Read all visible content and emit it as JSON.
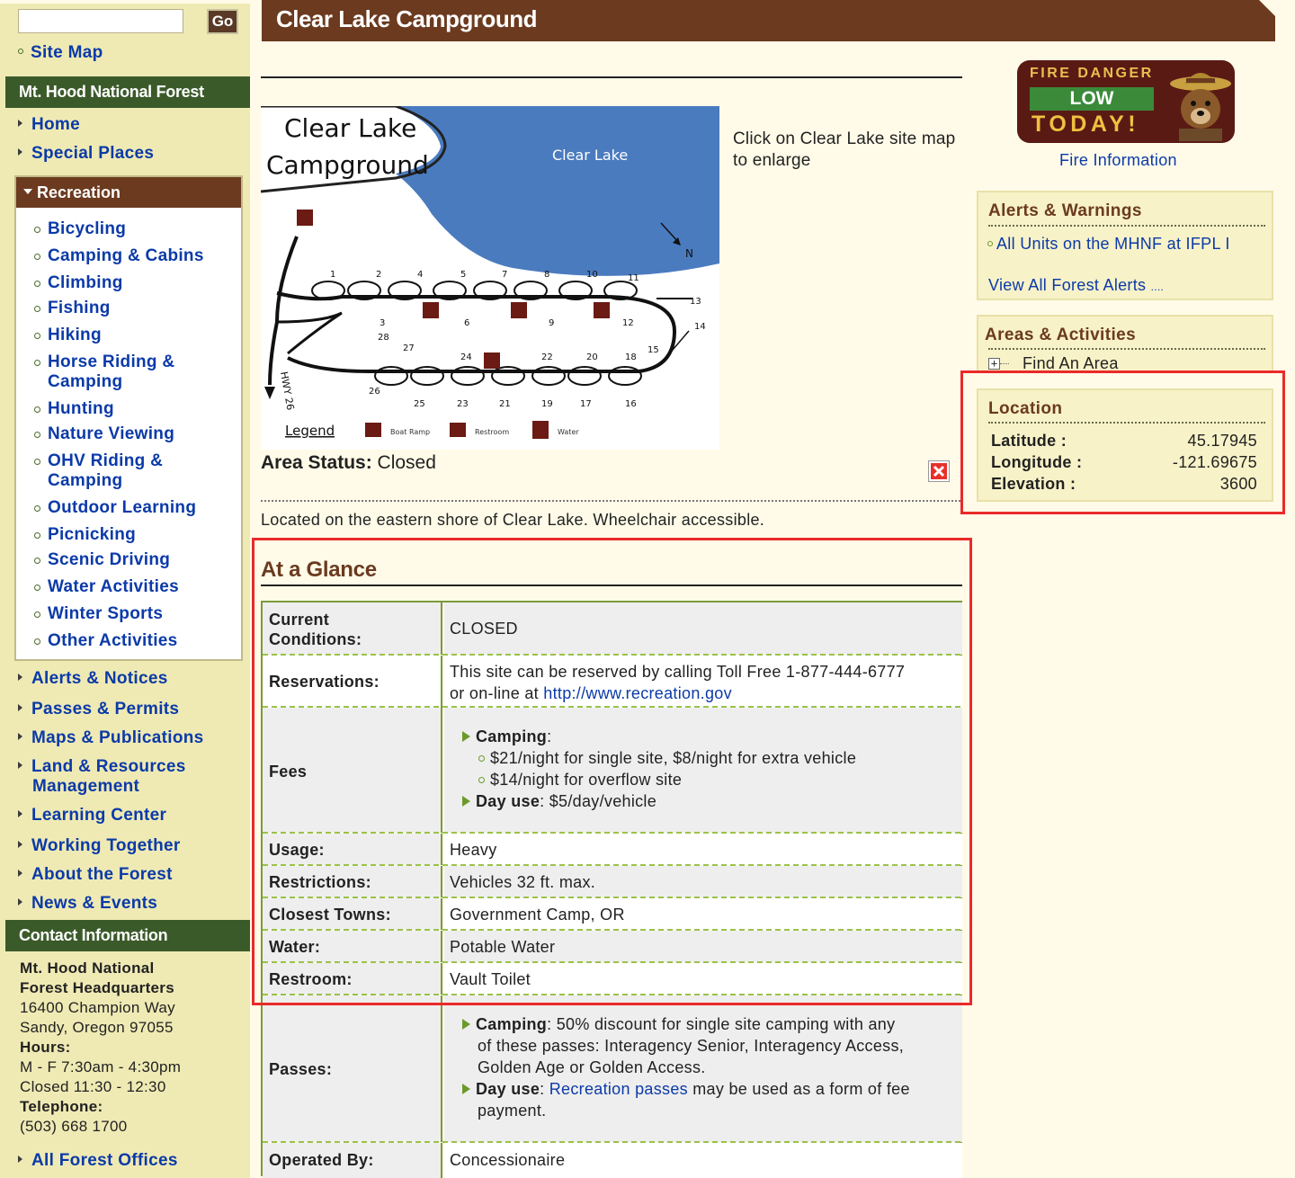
{
  "search": {
    "button": "Go"
  },
  "sidebar": {
    "site_map": "Site Map",
    "forest_header": "Mt. Hood National Forest",
    "nav_top": [
      "Home",
      "Special Places"
    ],
    "recreation_header": "Recreation",
    "recreation_items": [
      "Bicycling",
      "Camping & Cabins",
      "Climbing",
      "Fishing",
      "Hiking",
      "Horse Riding &",
      "Camping",
      "Hunting",
      "Nature Viewing",
      "OHV Riding &",
      "Camping",
      "Outdoor Learning",
      "Picnicking",
      "Scenic Driving",
      "Water Activities",
      "Winter Sports",
      "Other Activities"
    ],
    "nav_bottom": [
      "Alerts & Notices",
      "Passes & Permits",
      "Maps & Publications",
      "Land & Resources",
      "Management",
      "Learning Center",
      "Working Together",
      "About the Forest",
      "News & Events"
    ],
    "contact_header": "Contact Information",
    "contact": {
      "org_line1": "Mt. Hood National",
      "org_line2": "Forest Headquarters",
      "street": "16400 Champion Way",
      "city": "Sandy, Oregon 97055",
      "hours_label": "Hours:",
      "hours_line1": "M - F 7:30am - 4:30pm",
      "hours_line2": "Closed 11:30 - 12:30",
      "phone_label": "Telephone:",
      "phone": "(503) 668 1700"
    },
    "all_offices": "All Forest Offices"
  },
  "page": {
    "title": "Clear Lake Campground",
    "map_caption": "Click on Clear Lake site map to enlarge",
    "area_status_label": "Area Status:",
    "area_status_value": "Closed",
    "description": "Located on the eastern shore of Clear Lake. Wheelchair accessible.",
    "glance_title": "At a Glance"
  },
  "map": {
    "title_line1": "Clear Lake",
    "title_line2": "Campground",
    "lake_label": "Clear Lake",
    "north": "N",
    "road": "HWY 26",
    "legend": "Legend",
    "legend_items": [
      "Boat Ramp",
      "Restroom",
      "Water"
    ],
    "site_numbers": [
      "1",
      "2",
      "4",
      "5",
      "7",
      "8",
      "10",
      "11",
      "13",
      "14",
      "3",
      "6",
      "9",
      "12",
      "28",
      "27",
      "24",
      "22",
      "20",
      "18",
      "15",
      "26",
      "25",
      "23",
      "21",
      "19",
      "17",
      "16"
    ]
  },
  "glance": {
    "current_label": "Current",
    "current_label2": "Conditions:",
    "current_value": "CLOSED",
    "reservations_label": "Reservations:",
    "reservations_line1": "This site can be reserved by calling Toll Free 1-877-444-6777",
    "reservations_line2_prefix": "or on-line at",
    "reservations_link": "http://www.recreation.gov",
    "fees_label": "Fees",
    "fees_camping": "Camping",
    "fees_single": "$21/night for single site, $8/night for extra vehicle",
    "fees_overflow": "$14/night for overflow site",
    "fees_day": "Day use",
    "fees_day_value": "$5/day/vehicle",
    "usage_label": "Usage:",
    "usage_value": "Heavy",
    "restrictions_label": "Restrictions:",
    "restrictions_value": "Vehicles 32 ft. max.",
    "towns_label": "Closest Towns:",
    "towns_value": "Government Camp, OR",
    "water_label": "Water:",
    "water_value": "Potable Water",
    "restroom_label": "Restroom:",
    "restroom_value": "Vault Toilet",
    "passes_label": "Passes:",
    "passes_camping": "Camping",
    "passes_line1": "50% discount for single site camping with any",
    "passes_line2": "of these passes: Interagency Senior, Interagency Access,",
    "passes_line3": "Golden Age or Golden Access.",
    "passes_day": "Day use",
    "passes_link": "Recreation passes",
    "passes_day_rest": "may be used as a form of fee",
    "passes_line5": "payment.",
    "operated_label": "Operated By:",
    "operated_value": "Concessionaire"
  },
  "right": {
    "fire_danger": "FIRE DANGER",
    "fire_level": "LOW",
    "fire_today": "TODAY!",
    "fire_info": "Fire Information",
    "alerts_title": "Alerts & Warnings",
    "alerts_item": "All Units on the MHNF at IFPL I",
    "alerts_view_all": "View All Forest Alerts",
    "alerts_more": "....",
    "areas_title": "Areas & Activities",
    "areas_find": "Find An Area",
    "location_title": "Location",
    "latitude_label": "Latitude :",
    "latitude_value": "45.17945",
    "longitude_label": "Longitude :",
    "longitude_value": "-121.69675",
    "elevation_label": "Elevation :",
    "elevation_value": "3600"
  },
  "colors": {
    "title_brown": "#6b3a1f",
    "nav_green": "#3b5a2a",
    "sidebar_bg": "#efeab4",
    "link_blue": "#0b3aa8",
    "highlight_red": "#ea2a2a",
    "table_border_green": "#7a9a3a"
  }
}
